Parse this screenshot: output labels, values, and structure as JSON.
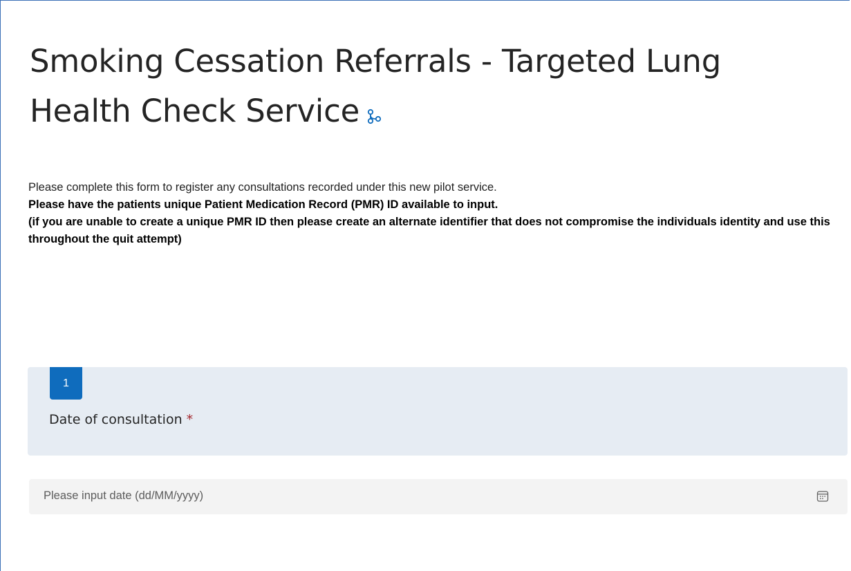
{
  "form": {
    "title": "Smoking Cessation Referrals - Targeted Lung Health Check Service",
    "branch_icon": "branching-icon",
    "description_line1": "Please complete this form to register any consultations recorded under this new pilot service.",
    "description_line2": "Please have the patients unique Patient Medication Record (PMR) ID available to input.",
    "description_line3": "(if you are unable to create a unique PMR ID then please create an alternate identifier that does not compromise the individuals identity and use this throughout the quit attempt)"
  },
  "question": {
    "number": "1",
    "label": "Date of consultation",
    "required_marker": "*",
    "input_placeholder": "Please input date (dd/MM/yyyy)",
    "input_icon": "calendar-icon"
  },
  "colors": {
    "accent": "#0f6cbd",
    "card_background": "#e6ecf3",
    "input_background": "#f3f3f3",
    "required": "#a4262c"
  }
}
